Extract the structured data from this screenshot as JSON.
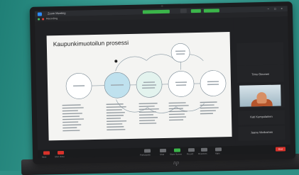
{
  "app": {
    "title": "Zoom Meeting",
    "share_indicator": "",
    "recording_label": "Recording",
    "window_controls": "– □ ×"
  },
  "slide": {
    "title": "Kaupunkimuotoilun prosessi",
    "nodes": [
      {
        "label": "",
        "fill": "#ffffff"
      },
      {
        "label": "",
        "fill": "#bfe1ee"
      },
      {
        "label": "",
        "fill": "#e3f3ee"
      },
      {
        "label": "",
        "fill": "#ffffff"
      },
      {
        "label": "",
        "fill": "#ffffff"
      }
    ],
    "top_node": {
      "label": ""
    }
  },
  "participants": [
    {
      "name": ""
    },
    {
      "name": "Timo Oinonen"
    },
    {
      "name": ""
    },
    {
      "name": "Kati Kumpulainen"
    },
    {
      "name": "Jaana Viinikainen"
    }
  ],
  "toolbar": {
    "items": [
      {
        "label": "Mute",
        "icon": "microphone-icon"
      },
      {
        "label": "Start Video",
        "icon": "video-camera-icon"
      },
      {
        "label": "Participants",
        "icon": "participants-icon"
      },
      {
        "label": "Chat",
        "icon": "chat-icon"
      },
      {
        "label": "Share Screen",
        "icon": "share-screen-icon"
      },
      {
        "label": "Record",
        "icon": "record-icon"
      },
      {
        "label": "Reactions",
        "icon": "reactions-icon"
      },
      {
        "label": "Apps",
        "icon": "apps-icon"
      }
    ],
    "end_label": "End"
  },
  "laptop": {
    "brand": "hp"
  },
  "colors": {
    "zoom_blue": "#2d8cff",
    "share_green": "#3bb54a",
    "end_red": "#d9322b",
    "backdrop_teal": "#2f8f85"
  }
}
